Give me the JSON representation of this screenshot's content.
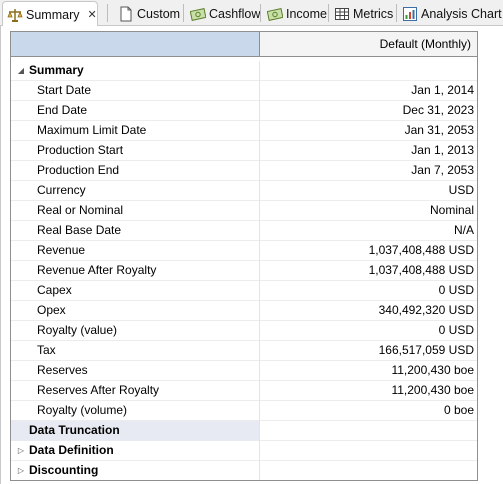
{
  "tabs": [
    {
      "label": "Summary",
      "icon": "scale-icon",
      "active": true
    },
    {
      "label": "Custom",
      "icon": "document-icon"
    },
    {
      "label": "Cashflow",
      "icon": "money-icon"
    },
    {
      "label": "Income",
      "icon": "money-icon"
    },
    {
      "label": "Metrics",
      "icon": "grid-icon"
    },
    {
      "label": "Analysis Chart",
      "icon": "chart-icon"
    }
  ],
  "table": {
    "column_header": "Default (Monthly)",
    "summary_group": "Summary",
    "rows": [
      {
        "label": "Start Date",
        "value": "Jan 1, 2014"
      },
      {
        "label": "End Date",
        "value": "Dec 31, 2023"
      },
      {
        "label": "Maximum Limit Date",
        "value": "Jan 31, 2053"
      },
      {
        "label": "Production Start",
        "value": "Jan 1, 2013"
      },
      {
        "label": "Production End",
        "value": "Jan 7, 2053"
      },
      {
        "label": "Currency",
        "value": "USD"
      },
      {
        "label": "Real or Nominal",
        "value": "Nominal"
      },
      {
        "label": "Real Base Date",
        "value": "N/A"
      },
      {
        "label": "Revenue",
        "value": "1,037,408,488 USD"
      },
      {
        "label": "Revenue After Royalty",
        "value": "1,037,408,488 USD"
      },
      {
        "label": "Capex",
        "value": "0 USD"
      },
      {
        "label": "Opex",
        "value": "340,492,320 USD"
      },
      {
        "label": "Royalty (value)",
        "value": "0 USD"
      },
      {
        "label": "Tax",
        "value": "166,517,059 USD"
      },
      {
        "label": "Reserves",
        "value": "11,200,430 boe"
      },
      {
        "label": "Reserves After Royalty",
        "value": "11,200,430 boe"
      },
      {
        "label": "Royalty (volume)",
        "value": "0 boe"
      }
    ],
    "collapsed_groups": [
      "Data Truncation",
      "Data Definition",
      "Discounting"
    ]
  }
}
